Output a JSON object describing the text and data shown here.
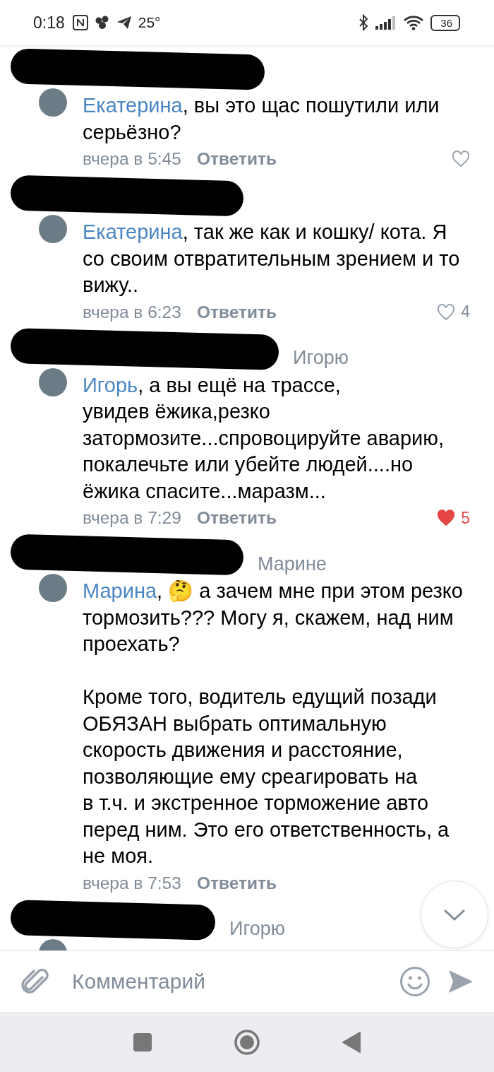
{
  "status_bar": {
    "time": "0:18",
    "temperature": "25°",
    "battery": "36"
  },
  "comments": [
    {
      "mention": "Екатерина",
      "text": ", вы это щас пошутили или серьёзно?",
      "time": "вчера в 5:45",
      "reply_label": "Ответить",
      "liked": false
    },
    {
      "mention": "Екатерина",
      "text": ", так же как и кошку/ кота. Я со своим отвратительным зрением и то вижу..",
      "time": "вчера в 6:23",
      "reply_label": "Ответить",
      "liked": false,
      "likes": "4"
    },
    {
      "reply_to": "Игорю",
      "mention": "Игорь",
      "text": ", а вы ещё на трассе,\nувидев ёжика,резко\nзатормозите...спровоцируйте аварию, покалечьте или убейте людей....но ёжика спасите...маразм...",
      "time": "вчера в 7:29",
      "reply_label": "Ответить",
      "liked": true,
      "likes": "5"
    },
    {
      "reply_to": "Марине",
      "mention": "Марина",
      "text": ", 🤔  а зачем мне при этом резко тормозить??? Могу я, скажем, над ним проехать?\n\nКроме того, водитель едущий позади ОБЯЗАН выбрать оптимальную скорость движения и расстояние, позволяющие ему среагировать на\nв т.ч. и экстренное торможение авто перед ним. Это его ответственность, а не моя.",
      "time": "вчера в 7:53",
      "reply_label": "Ответить"
    },
    {
      "reply_to": "Игорю"
    }
  ],
  "composer": {
    "placeholder": "Комментарий"
  }
}
